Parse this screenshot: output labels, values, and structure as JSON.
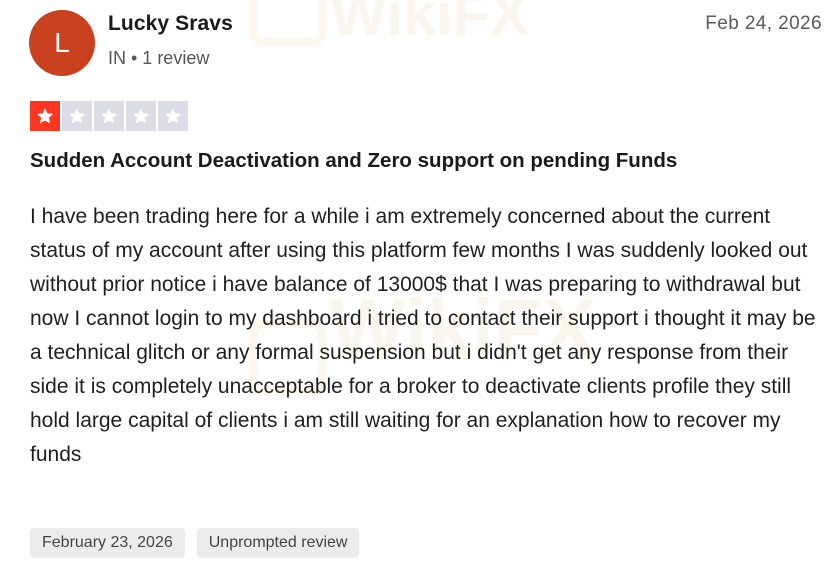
{
  "reviewer": {
    "initial": "L",
    "name": "Lucky Sravs",
    "meta": "IN • 1 review",
    "avatar_color": "#c8401e"
  },
  "review": {
    "date": "Feb 24, 2026",
    "rating": 1,
    "rating_max": 5,
    "title": "Sudden Account Deactivation and Zero support on pending Funds",
    "body": "I have been trading here for a while i am extremely concerned about the current status of my account after using this platform few months I was suddenly looked out without prior notice i have balance of 13000$ that I was preparing to withdrawal but now I cannot login to my dashboard i tried to contact their support i thought it may be a technical glitch or any formal suspension but i didn't get any response from their side it is completely unacceptable for a broker to deactivate clients profile they still hold large capital of clients i am still waiting for an explanation how to recover my funds"
  },
  "tags": {
    "experience_date": "February 23, 2026",
    "review_type": "Unprompted review"
  },
  "colors": {
    "star_filled": "#ff3722",
    "star_empty": "#dcdce6",
    "tag_bg": "#ececec"
  },
  "watermark": "WikiFX"
}
